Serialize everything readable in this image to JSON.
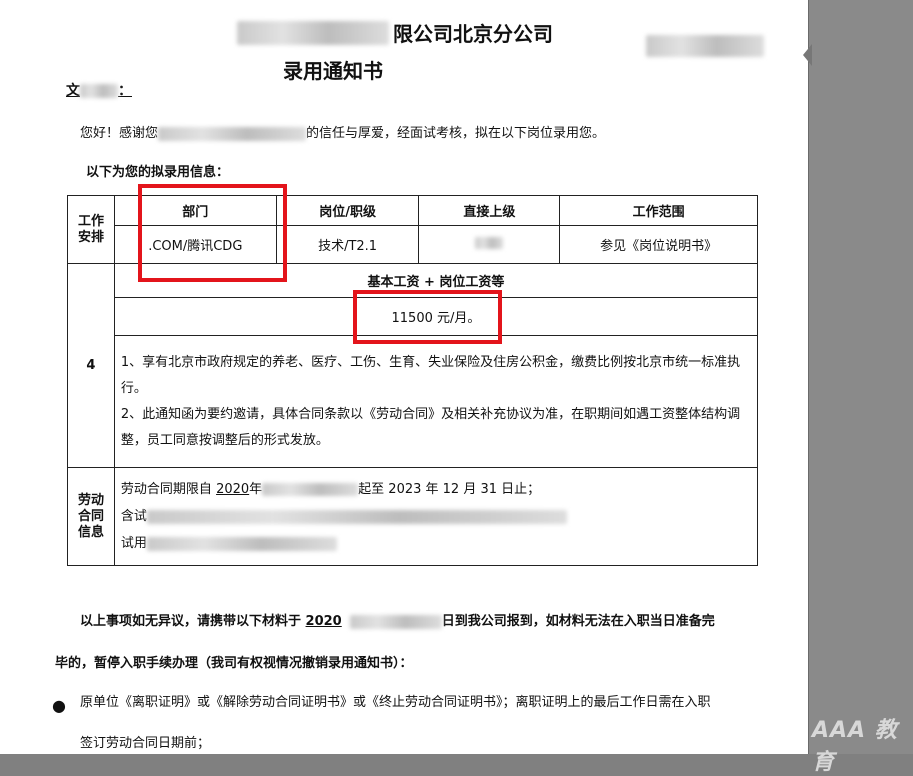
{
  "header": {
    "company_suffix": "限公司北京分公司",
    "doc_title": "录用通知书"
  },
  "greeting": {
    "name_prefix": "文",
    "name_suffix": "：",
    "line_prefix": "您好！感谢您",
    "line_suffix": "的信任与厚爱，经面试考核，拟在以下岗位录用您。"
  },
  "intro_label": "以下为您的拟录用信息：",
  "table": {
    "work_label": "工作安排",
    "headers": [
      "部门",
      "岗位/职级",
      "直接上级",
      "工作范围"
    ],
    "values": [
      ".COM/腾讯CDG",
      "技术/T2.1",
      "",
      "参见《岗位说明书》"
    ],
    "section_number": "4",
    "salary_header": "基本工资 + 岗位工资等",
    "salary_value": "11500 元/月。",
    "benefit_1": "1、享有北京市政府规定的养老、医疗、工伤、生育、失业保险及住房公积金，缴费比例按北京市统一标准执行。",
    "benefit_2": "2、此通知函为要约邀请，具体合同条款以《劳动合同》及相关补充协议为准，在职期间如遇工资整体结构调整，员工同意按调整后的形式发放。",
    "contract_label": "劳动合同信息",
    "contract_line1_prefix": "劳动合同期限自",
    "contract_line1_year": "2020",
    "contract_line1_mid": "年",
    "contract_line1_suffix": "起至 2023 年  12 月 31 日止；",
    "contract_line2": "含试",
    "contract_line3": "试用"
  },
  "footer": {
    "line1_prefix": "以上事项如无异议，请携带以下材料于",
    "line1_year": "2020",
    "line1_suffix": "日到我公司报到，如材料无法在入职当日准备完",
    "line2": "毕的，暂停入职手续办理（我司有权视情况撤销录用通知书）：",
    "bullet_text": "原单位《离职证明》或《解除劳动合同证明书》或《终止劳动合同证明书》；离职证明上的最后工作日需在入职",
    "bullet_text_2": "签订劳动合同日期前；"
  },
  "watermark": "AAA 教育"
}
